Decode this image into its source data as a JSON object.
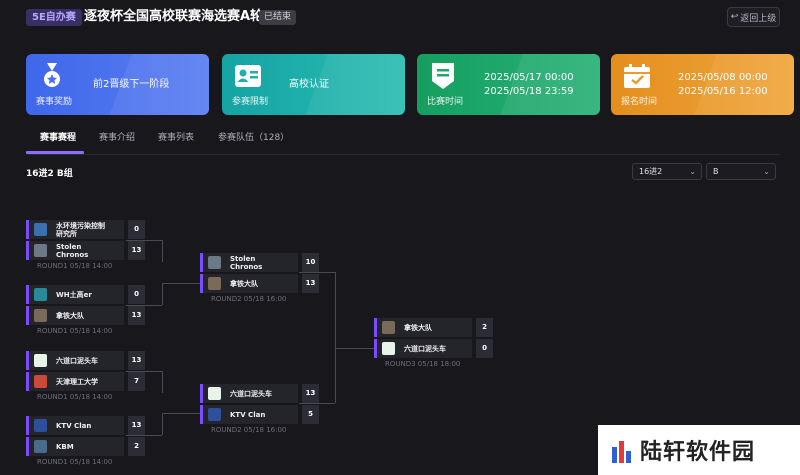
{
  "header": {
    "tag": "5E自办赛",
    "title": "逐夜杯全国高校联赛海选赛A轮",
    "status": "已结束",
    "back_label": "返回上级"
  },
  "cards": [
    {
      "label": "赛事奖励",
      "lines": [
        "前2晋级下一阶段"
      ],
      "icon": "medal-icon",
      "color": "#4a6ff0"
    },
    {
      "label": "参赛限制",
      "lines": [
        "高校认证"
      ],
      "icon": "id-card-icon",
      "color": "#1fb0ab"
    },
    {
      "label": "比赛时间",
      "lines": [
        "2025/05/17 00:00",
        "2025/05/18 23:59"
      ],
      "icon": "schedule-icon",
      "color": "#1fa86b"
    },
    {
      "label": "报名时间",
      "lines": [
        "2025/05/08 00:00",
        "2025/05/16 12:00"
      ],
      "icon": "calendar-icon",
      "color": "#eb9b2d"
    }
  ],
  "tabs": [
    "赛事赛程",
    "赛事介绍",
    "赛事列表",
    "参赛队伍（128）"
  ],
  "group_title": "16进2 B组",
  "selects": {
    "stage": "16进2",
    "group": "B"
  },
  "bracket": {
    "round1": [
      {
        "teams": [
          {
            "name": "水环境污染控制研究所",
            "score": "0"
          },
          {
            "name": "Stolen Chronos",
            "score": "13"
          }
        ],
        "label": "ROUND1 05/18 14:00"
      },
      {
        "teams": [
          {
            "name": "WH土高er",
            "score": "0"
          },
          {
            "name": "拿铁大队",
            "score": "13"
          }
        ],
        "label": "ROUND1 05/18 14:00"
      },
      {
        "teams": [
          {
            "name": "六道口泥头车",
            "score": "13"
          },
          {
            "name": "天津理工大学",
            "score": "7"
          }
        ],
        "label": "ROUND1 05/18 14:00"
      },
      {
        "teams": [
          {
            "name": "KTV Clan",
            "score": "13"
          },
          {
            "name": "KBM",
            "score": "2"
          }
        ],
        "label": "ROUND1 05/18 14:00"
      }
    ],
    "round2": [
      {
        "teams": [
          {
            "name": "Stolen Chronos",
            "score": "10"
          },
          {
            "name": "拿铁大队",
            "score": "13"
          }
        ],
        "label": "ROUND2 05/18 16:00"
      },
      {
        "teams": [
          {
            "name": "六道口泥头车",
            "score": "13"
          },
          {
            "name": "KTV Clan",
            "score": "5"
          }
        ],
        "label": "ROUND2 05/18 16:00"
      }
    ],
    "round3": [
      {
        "teams": [
          {
            "name": "拿铁大队",
            "score": "2"
          },
          {
            "name": "六道口泥头车",
            "score": "0"
          }
        ],
        "label": "ROUND3 05/18 18:00"
      }
    ]
  },
  "watermark": "陆轩软件园"
}
